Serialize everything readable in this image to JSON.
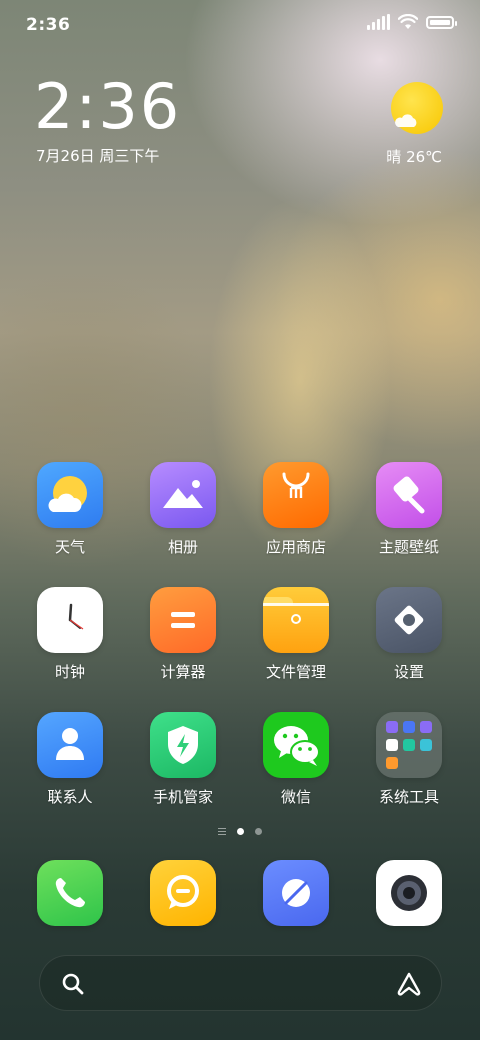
{
  "status_bar": {
    "time": "2:36",
    "battery_level": 1.0
  },
  "clock_widget": {
    "time": "2:36",
    "date": "7月26日 周三下午"
  },
  "weather_widget": {
    "icon": "sun-cloud-icon",
    "text": "晴 26℃"
  },
  "apps": [
    {
      "label": "天气",
      "icon": "weather-icon"
    },
    {
      "label": "相册",
      "icon": "gallery-icon"
    },
    {
      "label": "应用商店",
      "icon": "app-store-icon"
    },
    {
      "label": "主题壁纸",
      "icon": "themes-icon"
    },
    {
      "label": "时钟",
      "icon": "clock-icon"
    },
    {
      "label": "计算器",
      "icon": "calculator-icon"
    },
    {
      "label": "文件管理",
      "icon": "file-manager-icon"
    },
    {
      "label": "设置",
      "icon": "settings-icon"
    },
    {
      "label": "联系人",
      "icon": "contacts-icon"
    },
    {
      "label": "手机管家",
      "icon": "security-icon"
    },
    {
      "label": "微信",
      "icon": "wechat-icon"
    },
    {
      "label": "系统工具",
      "icon": "folder-icon"
    }
  ],
  "page_indicator": {
    "pages": 2,
    "current": 1
  },
  "dock": [
    {
      "icon": "phone-icon"
    },
    {
      "icon": "messages-icon"
    },
    {
      "icon": "browser-icon"
    },
    {
      "icon": "camera-icon"
    }
  ],
  "search_bar": {
    "left_icon": "search-icon",
    "right_icon": "assistant-icon"
  },
  "colors": {
    "weather_bg": "#3a8df7",
    "gallery_bg": "#8a6cf5",
    "store_bg": "#ff7a1a",
    "themes_bg": "#d46af0",
    "calculator_bg": "#ff7f30",
    "files_bg": "#ffb31f",
    "settings_bg": "#56606f",
    "contacts_bg": "#3f8ff8",
    "security_bg": "#2fcf78",
    "wechat_bg": "#1ec91e",
    "phone_bg": "#3fd04f",
    "messages_bg": "#ffc400",
    "browser_bg": "#4a76f5"
  }
}
